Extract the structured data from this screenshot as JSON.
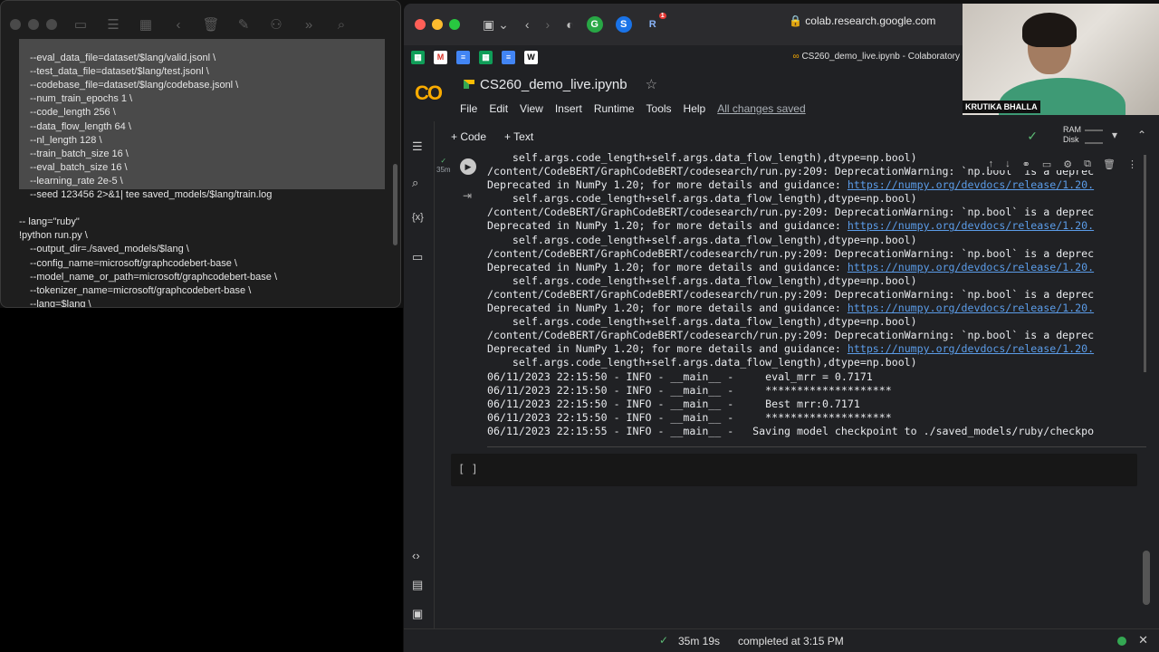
{
  "notes": {
    "lines": [
      "--eval_data_file=dataset/$lang/valid.jsonl \\",
      "--test_data_file=dataset/$lang/test.jsonl \\",
      "--codebase_file=dataset/$lang/codebase.jsonl \\",
      "--num_train_epochs 1 \\",
      "--code_length 256 \\",
      "--data_flow_length 64 \\",
      "--nl_length 128 \\",
      "--train_batch_size 16 \\",
      "--eval_batch_size 16 \\",
      "--learning_rate 2e-5 \\",
      "--seed 123456 2>&1| tee saved_models/$lang/train.log",
      "",
      "-- lang=\"ruby\"",
      "!python run.py \\",
      "--output_dir=./saved_models/$lang \\",
      "--config_name=microsoft/graphcodebert-base \\",
      "--model_name_or_path=microsoft/graphcodebert-base \\",
      "--tokenizer_name=microsoft/graphcodebert-base \\",
      "--lang=$lang \\"
    ]
  },
  "browser": {
    "url": "colab.research.google.com",
    "tab_title": "CS260_demo_live.ipynb - Colaboratory",
    "extension_badge": "1"
  },
  "colab": {
    "logo": "CO",
    "notebook_name": "CS260_demo_live.ipynb",
    "menus": [
      "File",
      "Edit",
      "View",
      "Insert",
      "Runtime",
      "Tools",
      "Help"
    ],
    "saved_status": "All changes saved",
    "add_code": "+ Code",
    "add_text": "+ Text",
    "ram_label": "RAM",
    "disk_label": "Disk",
    "exec_time": "35m",
    "output_lines": [
      {
        "t": "    self.args.code_length+self.args.data_flow_length),dtype=np.bool)"
      },
      {
        "t": "/content/CodeBERT/GraphCodeBERT/codesearch/run.py:209: DeprecationWarning: `np.bool` is a deprec"
      },
      {
        "t": "Deprecated in NumPy 1.20; for more details and guidance: ",
        "link": "https://numpy.org/devdocs/release/1.20."
      },
      {
        "t": "    self.args.code_length+self.args.data_flow_length),dtype=np.bool)"
      },
      {
        "t": "/content/CodeBERT/GraphCodeBERT/codesearch/run.py:209: DeprecationWarning: `np.bool` is a deprec"
      },
      {
        "t": "Deprecated in NumPy 1.20; for more details and guidance: ",
        "link": "https://numpy.org/devdocs/release/1.20."
      },
      {
        "t": "    self.args.code_length+self.args.data_flow_length),dtype=np.bool)"
      },
      {
        "t": "/content/CodeBERT/GraphCodeBERT/codesearch/run.py:209: DeprecationWarning: `np.bool` is a deprec"
      },
      {
        "t": "Deprecated in NumPy 1.20; for more details and guidance: ",
        "link": "https://numpy.org/devdocs/release/1.20."
      },
      {
        "t": "    self.args.code_length+self.args.data_flow_length),dtype=np.bool)"
      },
      {
        "t": "/content/CodeBERT/GraphCodeBERT/codesearch/run.py:209: DeprecationWarning: `np.bool` is a deprec"
      },
      {
        "t": "Deprecated in NumPy 1.20; for more details and guidance: ",
        "link": "https://numpy.org/devdocs/release/1.20."
      },
      {
        "t": "    self.args.code_length+self.args.data_flow_length),dtype=np.bool)"
      },
      {
        "t": "/content/CodeBERT/GraphCodeBERT/codesearch/run.py:209: DeprecationWarning: `np.bool` is a deprec"
      },
      {
        "t": "Deprecated in NumPy 1.20; for more details and guidance: ",
        "link": "https://numpy.org/devdocs/release/1.20."
      },
      {
        "t": "    self.args.code_length+self.args.data_flow_length),dtype=np.bool)"
      },
      {
        "t": "06/11/2023 22:15:50 - INFO - __main__ -     eval_mrr = 0.7171"
      },
      {
        "t": "06/11/2023 22:15:50 - INFO - __main__ -     ********************"
      },
      {
        "t": "06/11/2023 22:15:50 - INFO - __main__ -     Best mrr:0.7171"
      },
      {
        "t": "06/11/2023 22:15:50 - INFO - __main__ -     ********************"
      },
      {
        "t": "06/11/2023 22:15:55 - INFO - __main__ -   Saving model checkpoint to ./saved_models/ruby/checkpo"
      }
    ],
    "empty_cell": "[ ]",
    "status_duration": "35m 19s",
    "status_completed": "completed at 3:15 PM"
  },
  "webcam": {
    "name": "KRUTIKA BHALLA"
  },
  "colors": {
    "accent_orange": "#f9ab00",
    "link_blue": "#5b9ce8",
    "success_green": "#5bb974"
  }
}
